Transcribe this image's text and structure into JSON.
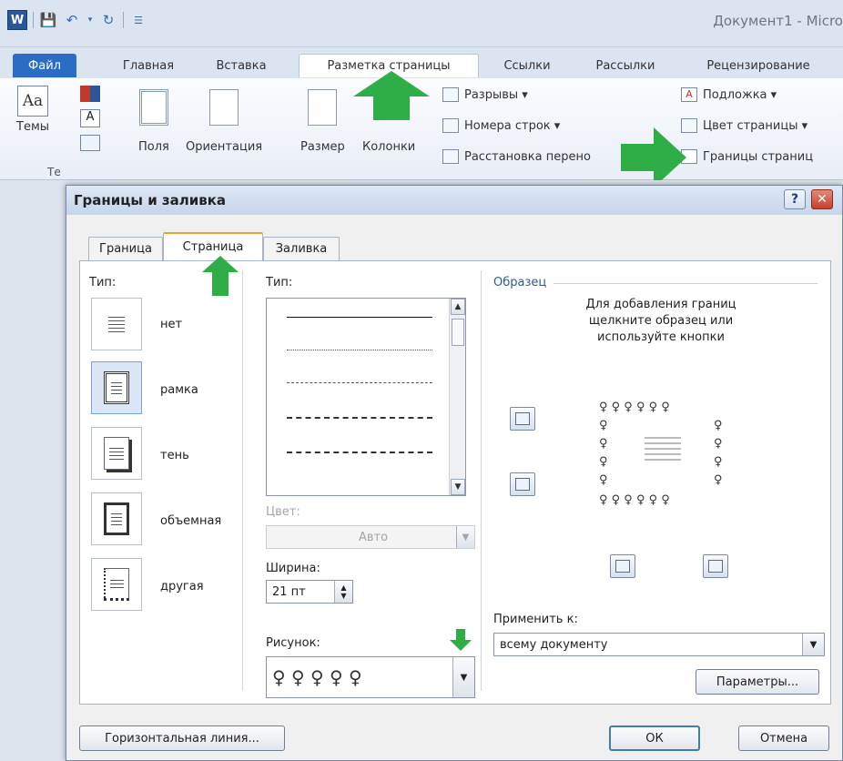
{
  "window": {
    "doc_title": "Документ1 - Micro"
  },
  "qat": {
    "word_letter": "W",
    "save_icon": "save-icon",
    "undo_icon": "undo-icon",
    "redo_icon": "redo-icon",
    "customize_icon": "customize-icon"
  },
  "tabs": [
    {
      "label": "Файл"
    },
    {
      "label": "Главная"
    },
    {
      "label": "Вставка"
    },
    {
      "label": "Разметка страницы"
    },
    {
      "label": "Ссылки"
    },
    {
      "label": "Рассылки"
    },
    {
      "label": "Рецензирование"
    }
  ],
  "ribbon": {
    "themes": "Темы",
    "margins": "Поля",
    "orientation": "Ориентация",
    "size": "Размер",
    "columns": "Колонки",
    "breaks": "Разрывы ▾",
    "line_numbers": "Номера строк ▾",
    "hyphenation": "Расстановка перено",
    "watermark": "Подложка ▾",
    "page_color": "Цвет страницы ▾",
    "page_borders": "Границы страниц",
    "group_label": "Те"
  },
  "dialog": {
    "title": "Границы и заливка",
    "help": "?",
    "close": "✕",
    "tabs": [
      {
        "label": "Граница"
      },
      {
        "label": "Страница"
      },
      {
        "label": "Заливка"
      }
    ],
    "setting_label": "Тип:",
    "settings": [
      {
        "label": "нет"
      },
      {
        "label": "рамка"
      },
      {
        "label": "тень"
      },
      {
        "label": "объемная"
      },
      {
        "label": "другая"
      }
    ],
    "style_label": "Тип:",
    "color_label": "Цвет:",
    "color_value": "Авто",
    "width_label": "Ширина:",
    "width_value": "21 пт",
    "art_label": "Рисунок:",
    "art_figures": "♀ ♀ ♀ ♀ ♀",
    "preview_label": "Образец",
    "preview_hint_1": "Для добавления границ",
    "preview_hint_2": "щелкните образец или",
    "preview_hint_3": "используйте кнопки",
    "apply_label": "Применить к:",
    "apply_value": "всему документу",
    "options_button": "Параметры...",
    "hline_button": "Горизонтальная линия...",
    "ok_button": "ОК",
    "cancel_button": "Отмена"
  },
  "colors": {
    "accent_green": "#2fae47",
    "file_tab": "#2b6cc4"
  }
}
